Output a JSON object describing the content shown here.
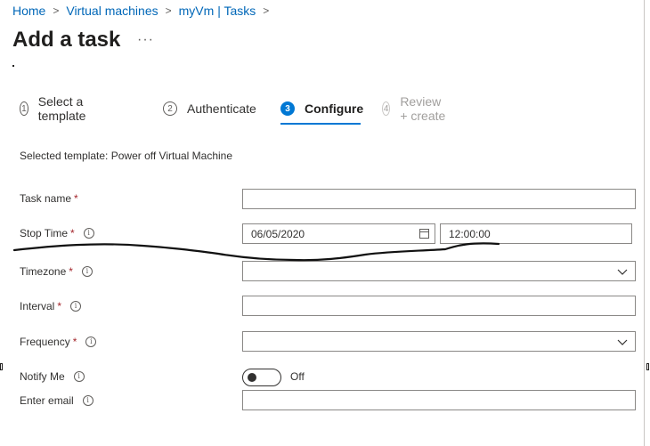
{
  "breadcrumb": {
    "items": [
      "Home",
      "Virtual machines",
      "myVm | Tasks"
    ],
    "separator": ">"
  },
  "page": {
    "title": "Add a task",
    "more": "···"
  },
  "steps": [
    {
      "num": "1",
      "label": "Select a template",
      "state": "complete"
    },
    {
      "num": "2",
      "label": "Authenticate",
      "state": "complete"
    },
    {
      "num": "3",
      "label": "Configure",
      "state": "active"
    },
    {
      "num": "4",
      "label": "Review + create",
      "state": "disabled"
    }
  ],
  "selected_template": "Selected template: Power off Virtual Machine",
  "form": {
    "task_name": {
      "label": "Task name",
      "required": "*",
      "value": ""
    },
    "stop_time": {
      "label": "Stop Time",
      "required": "*",
      "date": "06/05/2020",
      "time": "12:00:00"
    },
    "timezone": {
      "label": "Timezone",
      "required": "*",
      "value": ""
    },
    "interval": {
      "label": "Interval",
      "required": "*",
      "value": ""
    },
    "frequency": {
      "label": "Frequency",
      "required": "*",
      "value": ""
    },
    "notify_me": {
      "label": "Notify Me",
      "state": "Off"
    },
    "email": {
      "label": "Enter email",
      "value": ""
    }
  },
  "icons": {
    "info": "i",
    "chevron": "chevron-down-icon",
    "calendar": "calendar-icon"
  },
  "colors": {
    "accent": "#0078d4",
    "link": "#0067b8",
    "required": "#a4262c",
    "border": "#8a8886"
  }
}
